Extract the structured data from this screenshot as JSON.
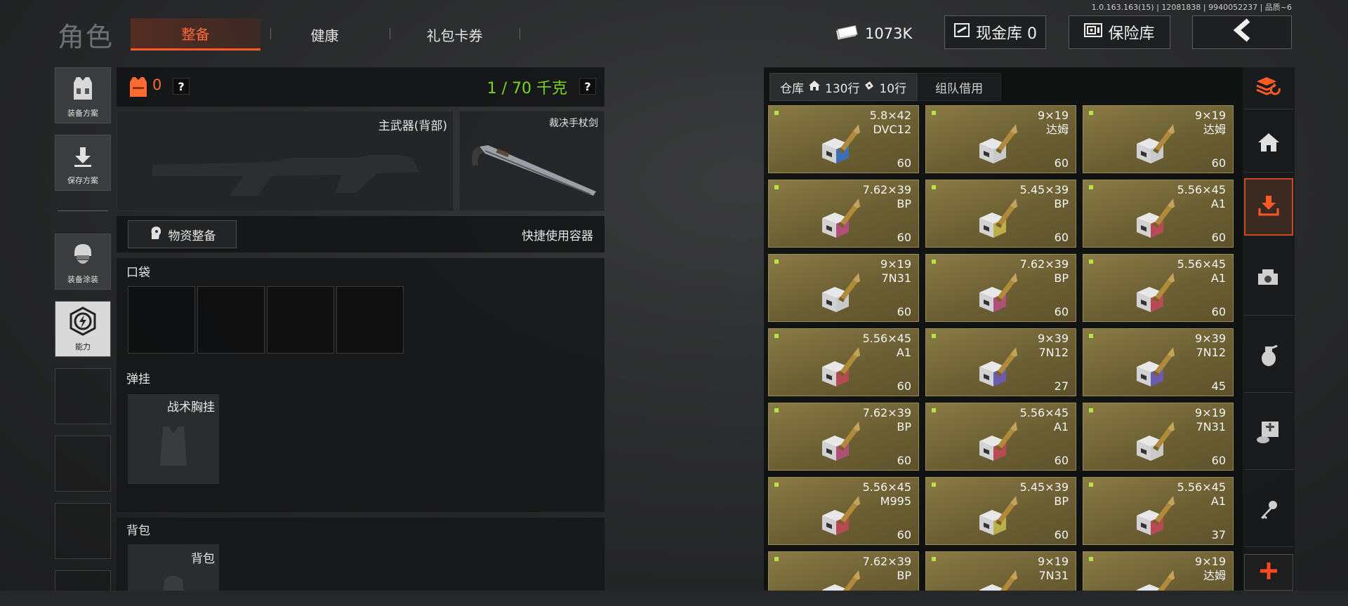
{
  "version": "1.0.163.163(15) | 12081838 | 9940052237 | 品质~6",
  "header": {
    "title": "角色",
    "tabs": [
      "整备",
      "健康",
      "礼包卡券"
    ],
    "money": "1073K",
    "cash_label": "现金库 0",
    "safe_label": "保险库"
  },
  "sidebar": {
    "items": [
      {
        "label": "装备方案",
        "icon": "vest-icon"
      },
      {
        "label": "保存方案",
        "icon": "download-icon"
      },
      {
        "label": "装备涂装",
        "icon": "helmet-icon"
      },
      {
        "label": "能力",
        "icon": "lightning-hex-icon"
      }
    ]
  },
  "loadout": {
    "armor_count": "0",
    "weight": "1 / 70 千克",
    "primary_weapon_label": "主武器(背部)",
    "melee_label": "裁决手杖剑",
    "supply_button": "物资整备",
    "quick_container": "快捷使用容器",
    "pocket_label": "口袋",
    "rig_section": "弹挂",
    "rig_slot_label": "战术胸挂",
    "backpack_section": "背包",
    "backpack_slot_label": "背包"
  },
  "warehouse": {
    "tab_label": "仓库",
    "rows_home": "130行",
    "rows_ticket": "10行",
    "team_tab": "组队借用",
    "items": [
      {
        "caliber": "5.8×42",
        "type": "DVC12",
        "qty": "60",
        "box": "#3d6fb8"
      },
      {
        "caliber": "9×19",
        "type": "达姆",
        "qty": "60",
        "box": "#c9c9c9"
      },
      {
        "caliber": "9×19",
        "type": "达姆",
        "qty": "60",
        "box": "#c9c9c9"
      },
      {
        "caliber": "7.62×39",
        "type": "BP",
        "qty": "60",
        "box": "#b0507a"
      },
      {
        "caliber": "5.45×39",
        "type": "BP",
        "qty": "60",
        "box": "#b9b04a"
      },
      {
        "caliber": "5.56×45",
        "type": "A1",
        "qty": "60",
        "box": "#b84a55"
      },
      {
        "caliber": "9×19",
        "type": "7N31",
        "qty": "60",
        "box": "#c9c9c9"
      },
      {
        "caliber": "7.62×39",
        "type": "BP",
        "qty": "60",
        "box": "#b0507a"
      },
      {
        "caliber": "5.56×45",
        "type": "A1",
        "qty": "60",
        "box": "#b84a55"
      },
      {
        "caliber": "5.56×45",
        "type": "A1",
        "qty": "60",
        "box": "#b84a55"
      },
      {
        "caliber": "9×39",
        "type": "7N12",
        "qty": "27",
        "box": "#6a5ab0"
      },
      {
        "caliber": "9×39",
        "type": "7N12",
        "qty": "45",
        "box": "#6a5ab0"
      },
      {
        "caliber": "7.62×39",
        "type": "BP",
        "qty": "60",
        "box": "#b0507a"
      },
      {
        "caliber": "5.56×45",
        "type": "A1",
        "qty": "60",
        "box": "#b84a55"
      },
      {
        "caliber": "9×19",
        "type": "7N31",
        "qty": "60",
        "box": "#c9c9c9"
      },
      {
        "caliber": "5.56×45",
        "type": "M995",
        "qty": "60",
        "box": "#b84a55"
      },
      {
        "caliber": "5.45×39",
        "type": "BP",
        "qty": "60",
        "box": "#b9b04a"
      },
      {
        "caliber": "5.56×45",
        "type": "A1",
        "qty": "37",
        "box": "#b84a55"
      },
      {
        "caliber": "7.62×39",
        "type": "BP",
        "qty": "",
        "box": "#b0507a"
      },
      {
        "caliber": "9×19",
        "type": "7N31",
        "qty": "",
        "box": "#c9c9c9"
      },
      {
        "caliber": "9×19",
        "type": "达姆",
        "qty": "",
        "box": "#c9c9c9"
      }
    ]
  },
  "rail": {
    "icons": [
      "layers-refresh-icon",
      "home-icon",
      "download-tray-icon",
      "sight-icon",
      "grenade-icon",
      "medkit-icon",
      "key-icon",
      "plus-icon"
    ]
  },
  "colors": {
    "accent": "#ff5a26",
    "weight_ok": "#7ed321",
    "cell_bg": "#7a6c3c"
  }
}
